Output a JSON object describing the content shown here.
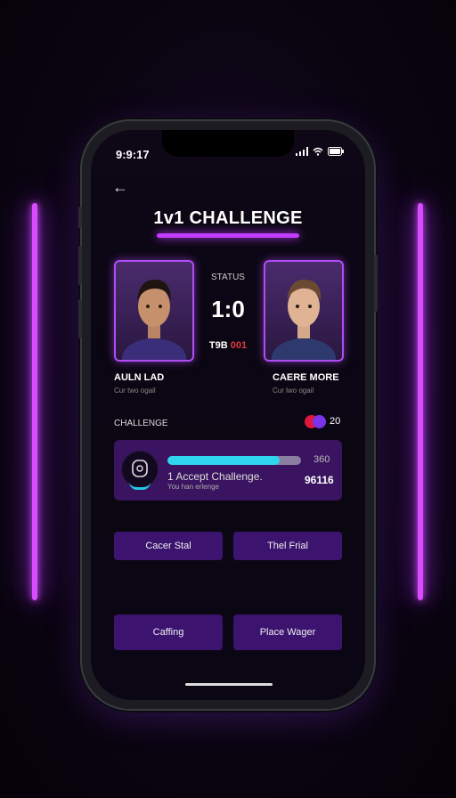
{
  "status_bar": {
    "time": "9:9:17"
  },
  "header": {
    "title": "1v1 CHALLENGE"
  },
  "match": {
    "status_label": "STATUS",
    "score": "1:0",
    "tbd_label": "T9B",
    "tbd_value": "001"
  },
  "players": [
    {
      "name": "AULN LAD",
      "subtitle": "Cur two ogail"
    },
    {
      "name": "CAERE MORE",
      "subtitle": "Cur lwo ogail"
    }
  ],
  "challenge": {
    "label": "CHALLENGE",
    "toggle_value": "20"
  },
  "card": {
    "top_right_value": "360",
    "title": "1 Accept Challenge.",
    "subtitle": "You han erlenge",
    "amount": "96116",
    "progress": 0.84
  },
  "buttons": {
    "row1_left": "Cacer Stal",
    "row1_right": "Thel Frial",
    "row2_left": "Caffing",
    "row2_right": "Place Wager"
  },
  "colors": {
    "neon": "#d84bff",
    "accent": "#c13cff",
    "progress": "#2fd4ee",
    "button_bg": "#3c1470"
  }
}
